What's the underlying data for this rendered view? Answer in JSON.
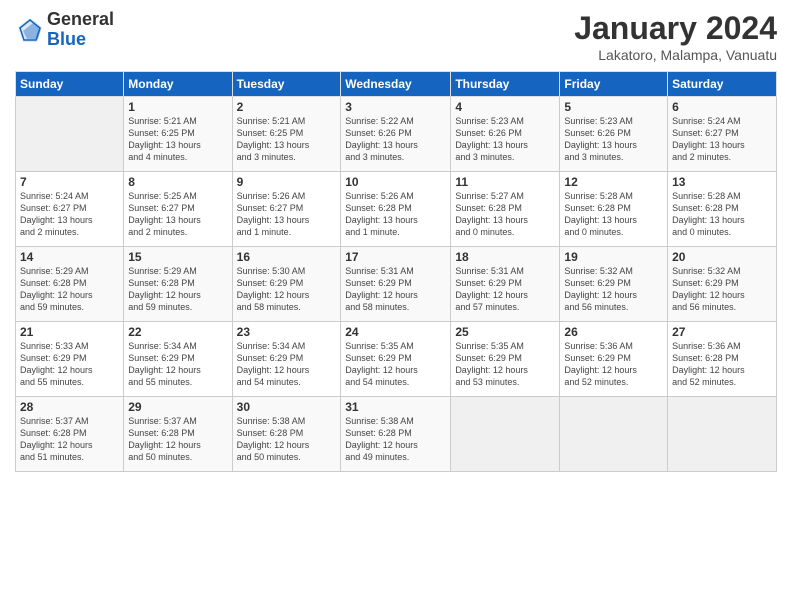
{
  "logo": {
    "general": "General",
    "blue": "Blue"
  },
  "header": {
    "month": "January 2024",
    "location": "Lakatoro, Malampa, Vanuatu"
  },
  "columns": [
    "Sunday",
    "Monday",
    "Tuesday",
    "Wednesday",
    "Thursday",
    "Friday",
    "Saturday"
  ],
  "weeks": [
    [
      {
        "day": "",
        "info": ""
      },
      {
        "day": "1",
        "info": "Sunrise: 5:21 AM\nSunset: 6:25 PM\nDaylight: 13 hours\nand 4 minutes."
      },
      {
        "day": "2",
        "info": "Sunrise: 5:21 AM\nSunset: 6:25 PM\nDaylight: 13 hours\nand 3 minutes."
      },
      {
        "day": "3",
        "info": "Sunrise: 5:22 AM\nSunset: 6:26 PM\nDaylight: 13 hours\nand 3 minutes."
      },
      {
        "day": "4",
        "info": "Sunrise: 5:23 AM\nSunset: 6:26 PM\nDaylight: 13 hours\nand 3 minutes."
      },
      {
        "day": "5",
        "info": "Sunrise: 5:23 AM\nSunset: 6:26 PM\nDaylight: 13 hours\nand 3 minutes."
      },
      {
        "day": "6",
        "info": "Sunrise: 5:24 AM\nSunset: 6:27 PM\nDaylight: 13 hours\nand 2 minutes."
      }
    ],
    [
      {
        "day": "7",
        "info": "Sunrise: 5:24 AM\nSunset: 6:27 PM\nDaylight: 13 hours\nand 2 minutes."
      },
      {
        "day": "8",
        "info": "Sunrise: 5:25 AM\nSunset: 6:27 PM\nDaylight: 13 hours\nand 2 minutes."
      },
      {
        "day": "9",
        "info": "Sunrise: 5:26 AM\nSunset: 6:27 PM\nDaylight: 13 hours\nand 1 minute."
      },
      {
        "day": "10",
        "info": "Sunrise: 5:26 AM\nSunset: 6:28 PM\nDaylight: 13 hours\nand 1 minute."
      },
      {
        "day": "11",
        "info": "Sunrise: 5:27 AM\nSunset: 6:28 PM\nDaylight: 13 hours\nand 0 minutes."
      },
      {
        "day": "12",
        "info": "Sunrise: 5:28 AM\nSunset: 6:28 PM\nDaylight: 13 hours\nand 0 minutes."
      },
      {
        "day": "13",
        "info": "Sunrise: 5:28 AM\nSunset: 6:28 PM\nDaylight: 13 hours\nand 0 minutes."
      }
    ],
    [
      {
        "day": "14",
        "info": "Sunrise: 5:29 AM\nSunset: 6:28 PM\nDaylight: 12 hours\nand 59 minutes."
      },
      {
        "day": "15",
        "info": "Sunrise: 5:29 AM\nSunset: 6:28 PM\nDaylight: 12 hours\nand 59 minutes."
      },
      {
        "day": "16",
        "info": "Sunrise: 5:30 AM\nSunset: 6:29 PM\nDaylight: 12 hours\nand 58 minutes."
      },
      {
        "day": "17",
        "info": "Sunrise: 5:31 AM\nSunset: 6:29 PM\nDaylight: 12 hours\nand 58 minutes."
      },
      {
        "day": "18",
        "info": "Sunrise: 5:31 AM\nSunset: 6:29 PM\nDaylight: 12 hours\nand 57 minutes."
      },
      {
        "day": "19",
        "info": "Sunrise: 5:32 AM\nSunset: 6:29 PM\nDaylight: 12 hours\nand 56 minutes."
      },
      {
        "day": "20",
        "info": "Sunrise: 5:32 AM\nSunset: 6:29 PM\nDaylight: 12 hours\nand 56 minutes."
      }
    ],
    [
      {
        "day": "21",
        "info": "Sunrise: 5:33 AM\nSunset: 6:29 PM\nDaylight: 12 hours\nand 55 minutes."
      },
      {
        "day": "22",
        "info": "Sunrise: 5:34 AM\nSunset: 6:29 PM\nDaylight: 12 hours\nand 55 minutes."
      },
      {
        "day": "23",
        "info": "Sunrise: 5:34 AM\nSunset: 6:29 PM\nDaylight: 12 hours\nand 54 minutes."
      },
      {
        "day": "24",
        "info": "Sunrise: 5:35 AM\nSunset: 6:29 PM\nDaylight: 12 hours\nand 54 minutes."
      },
      {
        "day": "25",
        "info": "Sunrise: 5:35 AM\nSunset: 6:29 PM\nDaylight: 12 hours\nand 53 minutes."
      },
      {
        "day": "26",
        "info": "Sunrise: 5:36 AM\nSunset: 6:29 PM\nDaylight: 12 hours\nand 52 minutes."
      },
      {
        "day": "27",
        "info": "Sunrise: 5:36 AM\nSunset: 6:28 PM\nDaylight: 12 hours\nand 52 minutes."
      }
    ],
    [
      {
        "day": "28",
        "info": "Sunrise: 5:37 AM\nSunset: 6:28 PM\nDaylight: 12 hours\nand 51 minutes."
      },
      {
        "day": "29",
        "info": "Sunrise: 5:37 AM\nSunset: 6:28 PM\nDaylight: 12 hours\nand 50 minutes."
      },
      {
        "day": "30",
        "info": "Sunrise: 5:38 AM\nSunset: 6:28 PM\nDaylight: 12 hours\nand 50 minutes."
      },
      {
        "day": "31",
        "info": "Sunrise: 5:38 AM\nSunset: 6:28 PM\nDaylight: 12 hours\nand 49 minutes."
      },
      {
        "day": "",
        "info": ""
      },
      {
        "day": "",
        "info": ""
      },
      {
        "day": "",
        "info": ""
      }
    ]
  ]
}
